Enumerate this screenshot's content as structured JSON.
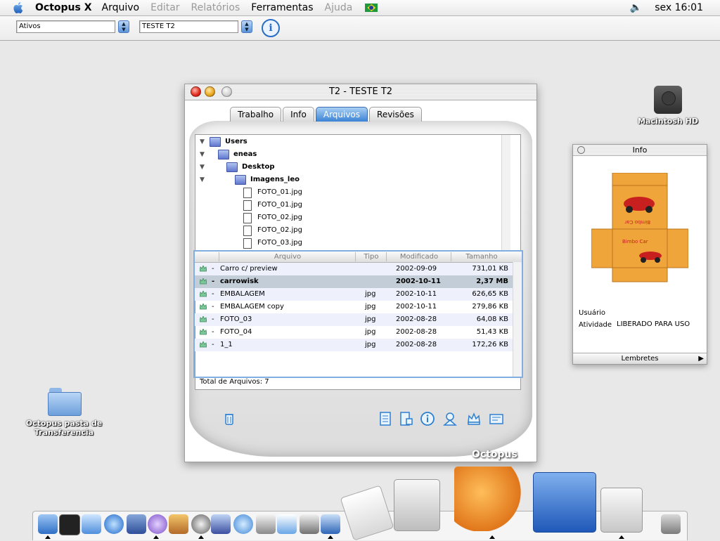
{
  "menubar": {
    "app_name": "Octopus X",
    "menus": [
      {
        "label": "Arquivo",
        "enabled": true
      },
      {
        "label": "Editar",
        "enabled": false
      },
      {
        "label": "Relatórios",
        "enabled": false
      },
      {
        "label": "Ferramentas",
        "enabled": true
      },
      {
        "label": "Ajuda",
        "enabled": false
      }
    ],
    "clock": "sex 16:01",
    "speaker_icon": "speaker-icon",
    "flag": "brazil-flag"
  },
  "toolbar": {
    "filter_value": "Ativos",
    "job_value": "TESTE T2",
    "info_glyph": "i"
  },
  "desktop": {
    "hd_label": "Macintosh HD",
    "folder_label_line1": "Octopus pasta de",
    "folder_label_line2": "Transferencia"
  },
  "window": {
    "title": "T2 - TESTE T2",
    "tabs": [
      {
        "label": "Trabalho",
        "active": false
      },
      {
        "label": "Info",
        "active": false
      },
      {
        "label": "Arquivos",
        "active": true
      },
      {
        "label": "Revisões",
        "active": false
      }
    ],
    "tree": [
      {
        "label": "Users",
        "kind": "folder"
      },
      {
        "label": "eneas",
        "kind": "folder"
      },
      {
        "label": "Desktop",
        "kind": "folder"
      },
      {
        "label": "Imagens_leo",
        "kind": "folder"
      },
      {
        "label": "FOTO_01.jpg",
        "kind": "file"
      },
      {
        "label": "FOTO_01.jpg",
        "kind": "file"
      },
      {
        "label": "FOTO_02.jpg",
        "kind": "file"
      },
      {
        "label": "FOTO_02.jpg",
        "kind": "file"
      },
      {
        "label": "FOTO_03.jpg",
        "kind": "file"
      }
    ],
    "table": {
      "columns": [
        "Arquivo",
        "Tipo",
        "Modificado",
        "Tamanho"
      ],
      "rows": [
        {
          "dash": "-",
          "name": "Carro c/ preview",
          "type": "",
          "modified": "2002-09-09",
          "size": "731,01 KB"
        },
        {
          "dash": "-",
          "name": "carrowisk",
          "type": "",
          "modified": "2002-10-11",
          "size": "2,37 MB"
        },
        {
          "dash": "-",
          "name": "EMBALAGEM",
          "type": "jpg",
          "modified": "2002-10-11",
          "size": "626,65 KB"
        },
        {
          "dash": "-",
          "name": "EMBALAGEM copy",
          "type": "jpg",
          "modified": "2002-10-11",
          "size": "279,86 KB"
        },
        {
          "dash": "-",
          "name": "FOTO_03",
          "type": "jpg",
          "modified": "2002-08-28",
          "size": "64,08 KB"
        },
        {
          "dash": "-",
          "name": "FOTO_04",
          "type": "jpg",
          "modified": "2002-08-28",
          "size": "51,43 KB"
        },
        {
          "dash": "-",
          "name": "1_1",
          "type": "jpg",
          "modified": "2002-08-28",
          "size": "172,26 KB"
        }
      ],
      "selected_index": 1
    },
    "total_label": "Total de Arquivos: 7",
    "brand": "Octopus"
  },
  "info_panel": {
    "title": "Info",
    "preview_text_1": "Bimbo Car",
    "preview_text_2": "Bimbo Car",
    "user_label": "Usuário",
    "activity_label": "Atividade",
    "activity_value": "LIBERADO PARA USO",
    "footer_label": "Lembretes"
  }
}
